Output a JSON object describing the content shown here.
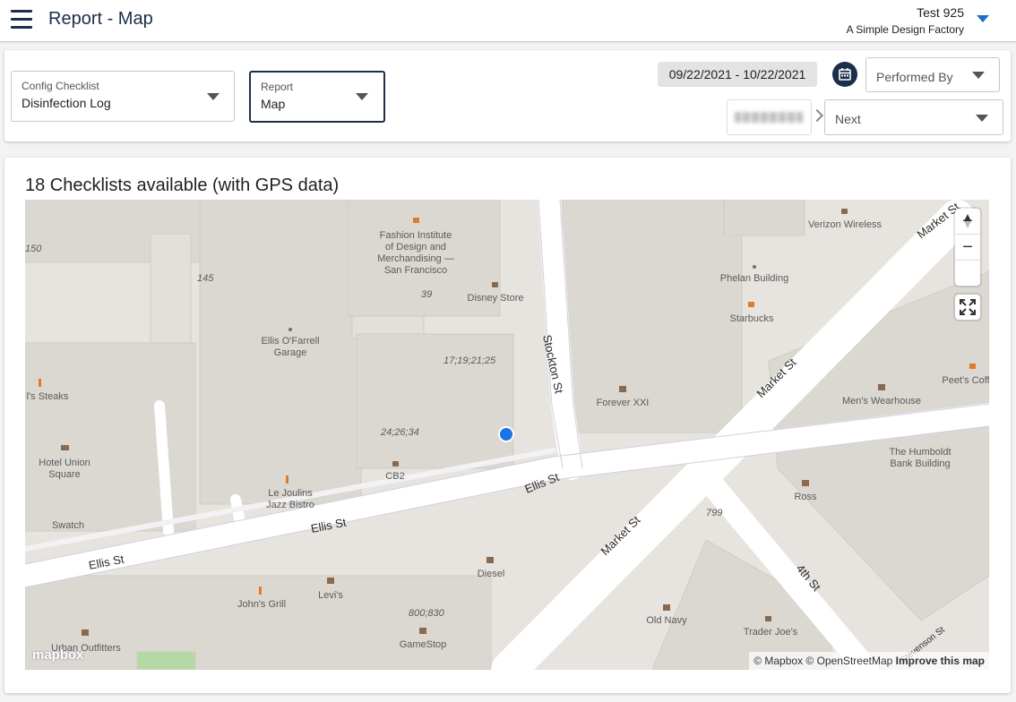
{
  "header": {
    "title": "Report - Map",
    "user_name": "Test 925",
    "org_name": "A Simple Design Factory"
  },
  "filters": {
    "config_checklist": {
      "label": "Config Checklist",
      "value": "Disinfection Log"
    },
    "report": {
      "label": "Report",
      "value": "Map"
    },
    "date_range": "09/22/2021 - 10/22/2021",
    "performed_by": "Performed By",
    "next": "Next"
  },
  "map_section": {
    "heading": "18 Checklists available (with GPS data)",
    "controls": {
      "zoom_in": "+",
      "zoom_out": "−"
    },
    "attribution": {
      "text": "© Mapbox © OpenStreetMap",
      "improve": "Improve this map"
    },
    "logo": "mapbox",
    "places": {
      "fidm1": "Fashion Institute",
      "fidm2": "of Design and",
      "fidm3": "Merchandising —",
      "fidm4": "San Francisco",
      "disney": "Disney Store",
      "ellis_garage1": "Ellis O'Farrell",
      "ellis_garage2": "Garage",
      "steaks": "l's Steaks",
      "hotel1": "Hotel Union",
      "hotel2": "Square",
      "cb2": "CB2",
      "lejoulins1": "Le Joulins",
      "lejoulins2": "Jazz Bistro",
      "swatch": "Swatch",
      "diesel": "Diesel",
      "levis": "Levi's",
      "johns": "John's Grill",
      "gamestop": "GameStop",
      "urban": "Urban Outfitters",
      "verizon": "Verizon Wireless",
      "phelan": "Phelan Building",
      "starbucks": "Starbucks",
      "forever": "Forever XXI",
      "mens": "Men's Wearhouse",
      "peets": "Peet's Coff",
      "humboldt1": "The Humboldt",
      "humboldt2": "Bank Building",
      "ross": "Ross",
      "oldnavy": "Old Navy",
      "traderjoes": "Trader Joe's"
    },
    "streets": {
      "stockton": "Stockton St",
      "ellis1": "Ellis St",
      "ellis2": "Ellis St",
      "ellis3": "Ellis St",
      "market1": "Market St",
      "market2": "Market St",
      "market3": "Market St",
      "fourth": "4th St",
      "stevenson": "Stevenson St"
    },
    "numbers": [
      "150",
      "145",
      "39",
      "17;19;21;25",
      "24;26;34",
      "800;830",
      "799"
    ],
    "colors": {
      "map_bg": "#e7e4df",
      "road": "#ffffff",
      "marker": "#1a73e8",
      "poi_icon": "#8a6a4f"
    }
  }
}
